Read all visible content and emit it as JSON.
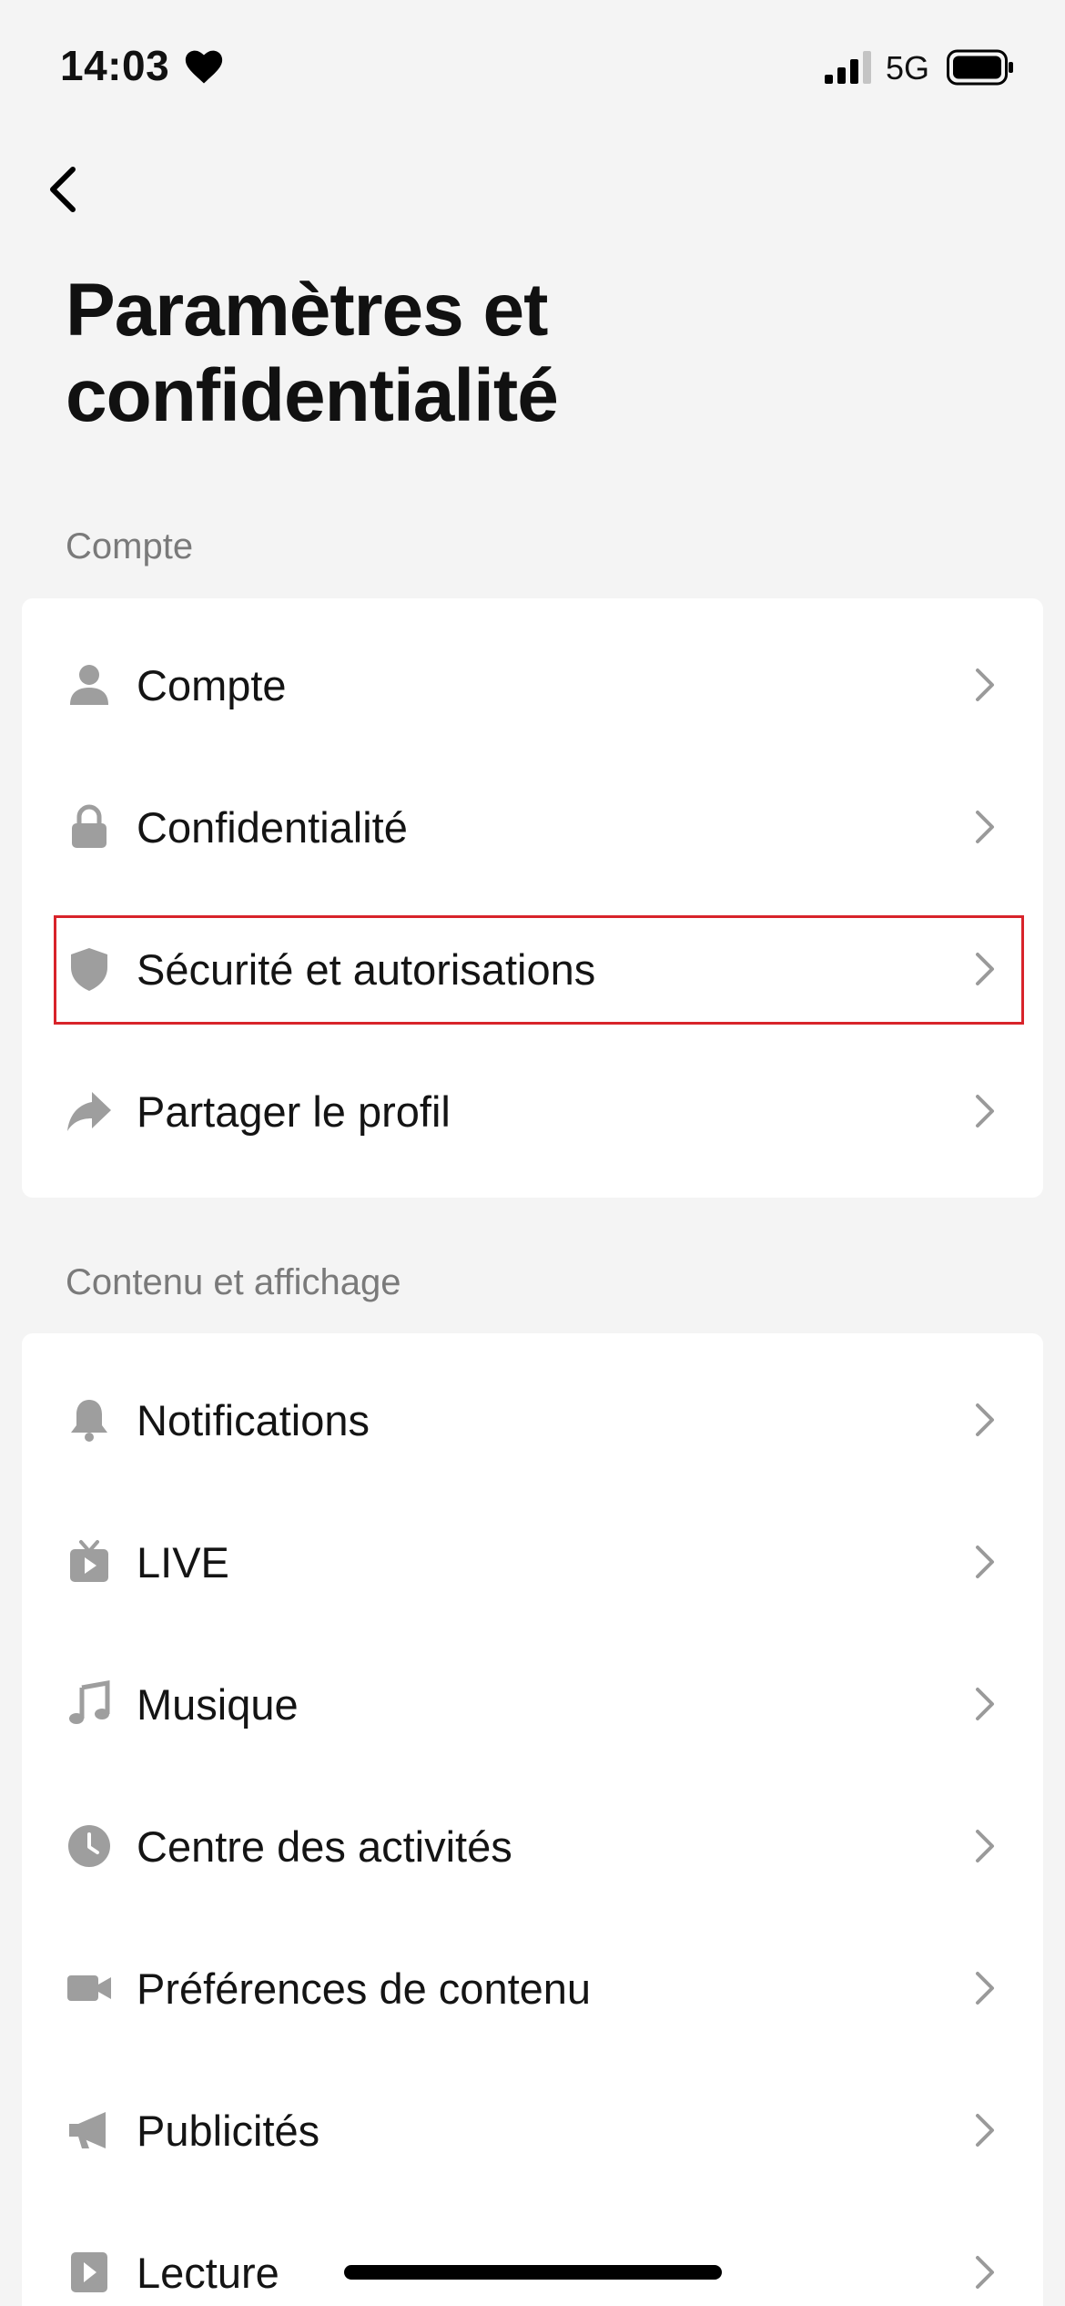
{
  "status_bar": {
    "time": "14:03",
    "network": "5G",
    "icons": [
      "heart-icon",
      "signal-icon",
      "battery-icon"
    ]
  },
  "nav": {
    "back_icon": "chevron-left-icon"
  },
  "page": {
    "title_line1": "Paramètres et",
    "title_line2": "confidentialité"
  },
  "sections": [
    {
      "header": "Compte",
      "items": [
        {
          "label": "Compte",
          "icon": "person-icon"
        },
        {
          "label": "Confidentialité",
          "icon": "lock-icon"
        },
        {
          "label": "Sécurité et autorisations",
          "icon": "shield-icon",
          "highlighted": true
        },
        {
          "label": "Partager le profil",
          "icon": "share-icon"
        }
      ]
    },
    {
      "header": "Contenu et affichage",
      "items": [
        {
          "label": "Notifications",
          "icon": "bell-icon"
        },
        {
          "label": "LIVE",
          "icon": "live-tv-icon"
        },
        {
          "label": "Musique",
          "icon": "music-note-icon"
        },
        {
          "label": "Centre des activités",
          "icon": "clock-icon"
        },
        {
          "label": "Préférences de contenu",
          "icon": "video-camera-icon"
        },
        {
          "label": "Publicités",
          "icon": "megaphone-icon"
        },
        {
          "label": "Lecture",
          "icon": "play-icon"
        }
      ]
    }
  ],
  "colors": {
    "background": "#f4f4f4",
    "card": "#ffffff",
    "icon_gray": "#9e9e9e",
    "section_header": "#7a7a7a",
    "highlight": "#d8232a"
  }
}
